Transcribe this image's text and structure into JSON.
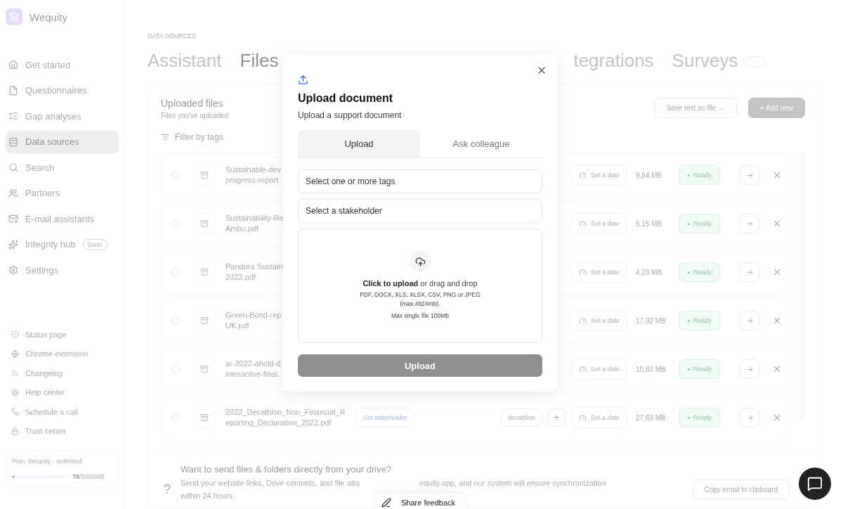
{
  "brand": {
    "name": "Wequity"
  },
  "nav": [
    {
      "label": "Get started",
      "selected": false
    },
    {
      "label": "Questionnaires",
      "selected": false
    },
    {
      "label": "Gap analyses",
      "selected": false
    },
    {
      "label": "Data sources",
      "selected": true
    },
    {
      "label": "Search",
      "selected": false
    },
    {
      "label": "Partners",
      "selected": false
    },
    {
      "label": "E-mail assistants",
      "selected": false
    },
    {
      "label": "Integrity hub",
      "selected": false,
      "badge": "Soon"
    },
    {
      "label": "Settings",
      "selected": false
    }
  ],
  "links": [
    {
      "label": "Status page"
    },
    {
      "label": "Chrome extension"
    },
    {
      "label": "Changelog"
    },
    {
      "label": "Help center"
    },
    {
      "label": "Schedule a call"
    },
    {
      "label": "Trust center"
    }
  ],
  "plan": {
    "label": "Plan: Wequity - unlimited",
    "level": 0.05,
    "used": "78",
    "total": "/5000MB"
  },
  "section": "DATA SOURCES",
  "tabs": [
    {
      "label": "Assistant",
      "selected": false
    },
    {
      "label": "Files",
      "selected": true
    }
  ],
  "tabs_after_modal": [
    {
      "label": "tegrations",
      "selected": false
    },
    {
      "label": "Surveys",
      "selected": false,
      "badge": true
    }
  ],
  "files": {
    "title": "Uploaded files",
    "subtitle": "Files you've uploaded",
    "filter": "Filter by tags",
    "save_button": "Save text as file →",
    "add_button": "+ Add new",
    "rows": [
      {
        "name": "Sustainable-dev\nprogress-report",
        "date": "Set a date",
        "size": "9,84 MB",
        "status": "Ready",
        "selected": false
      },
      {
        "name": "Sustainability-Re\nAmbu.pdf",
        "date": "Set a date",
        "size": "5,15 MB",
        "status": "Ready",
        "selected": false
      },
      {
        "name": "Pandora Sustain\n2023.pdf",
        "date": "Set a date",
        "size": "4,28 MB",
        "status": "Ready",
        "selected": false
      },
      {
        "name": "Green-Bond-rep\nUK.pdf",
        "date": "Set a date",
        "size": "17,92 MB",
        "status": "Ready",
        "selected": false
      },
      {
        "name": "ar-2022-ahold-d\ninteractive-final.",
        "date": "Set a date",
        "size": "10,83 MB",
        "status": "Ready",
        "selected": false
      },
      {
        "name": "2022_Decathlon_Non_Financial_R\neporting_Declaration_2022.pdf",
        "stakeholder": "Set stakeholder",
        "tag": "decathlon",
        "add_tag": "+",
        "date": "Set a date",
        "size": "27,69 MB",
        "status": "Ready",
        "selected": false
      }
    ]
  },
  "drive": {
    "mark": "?",
    "title": "Want to send files & folders directly from your drive?",
    "text_start": "Send your website links, Drive contents, and file atta",
    "text_end": "equity.app, and our system will ensure synchronization",
    "text_line2": "within 24 hours.",
    "button": "Copy email to clipboard"
  },
  "feedback": "Share feedback",
  "modal": {
    "title": "Upload document",
    "subtitle": "Upload a support document",
    "tabs": [
      {
        "label": "Upload",
        "selected": true
      },
      {
        "label": "Ask colleague",
        "selected": false
      }
    ],
    "tags_placeholder": "Select one or more tags",
    "stakeholder_placeholder": "Select a stakeholder",
    "drop_title": "**Click to upload** or drag and drop",
    "formats": "PDF, DOCX, XLS, XLSX, CSV, PNG or JPEG\n(max.4924mb).",
    "max": "Max single file 100Mb",
    "submit": "Upload",
    "submit_disabled": true
  }
}
